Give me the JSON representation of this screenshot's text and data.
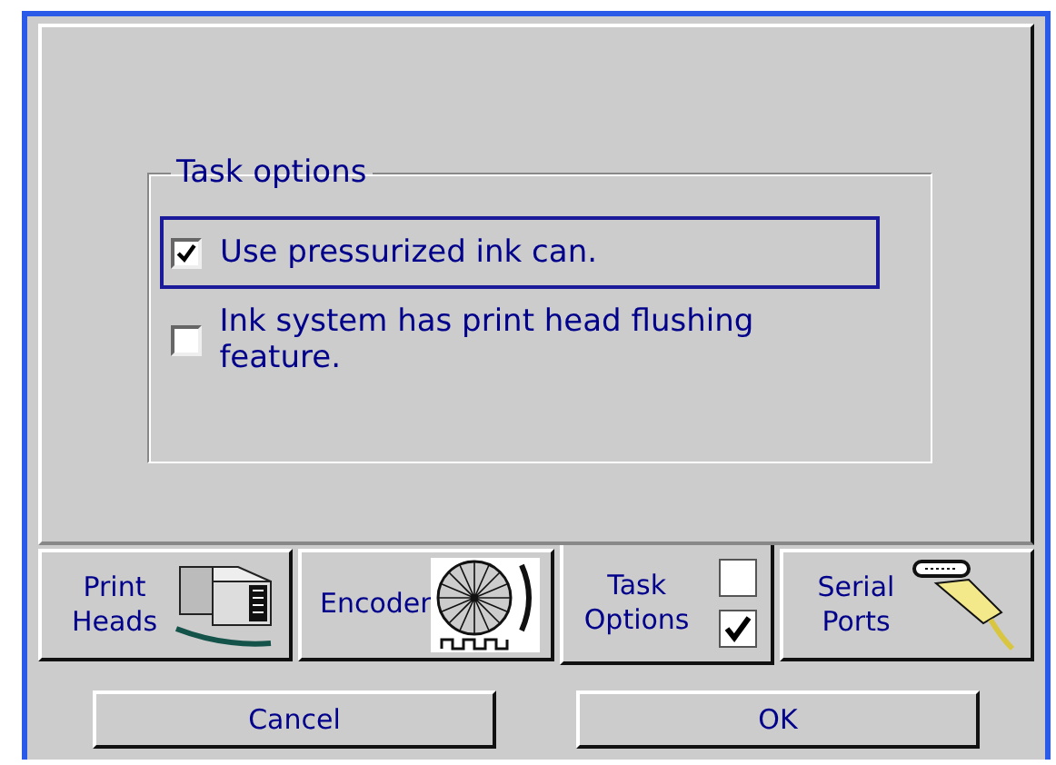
{
  "group": {
    "title": "Task options",
    "options": [
      {
        "label": "Use pressurized ink can.",
        "checked": true,
        "focused": true
      },
      {
        "label": "Ink system has print head flushing feature.",
        "checked": false,
        "focused": false
      }
    ]
  },
  "tabs": [
    {
      "label": "Print Heads",
      "kind": "printhead",
      "selected": false
    },
    {
      "label": "Encoder",
      "kind": "encoder",
      "selected": false
    },
    {
      "label": "Task Options",
      "kind": "checkboxes",
      "selected": true
    },
    {
      "label": "Serial Ports",
      "kind": "serial",
      "selected": false
    }
  ],
  "buttons": [
    "Cancel",
    "OK"
  ]
}
